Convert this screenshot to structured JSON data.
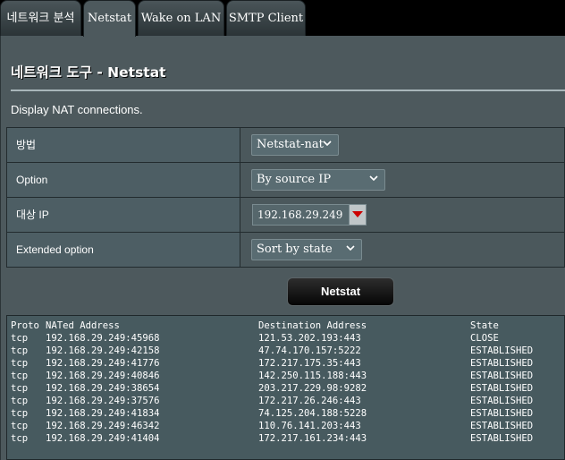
{
  "tabs": [
    {
      "label": "네트워크 분석"
    },
    {
      "label": "Netstat"
    },
    {
      "label": "Wake on LAN"
    },
    {
      "label": "SMTP Client"
    }
  ],
  "page": {
    "title": "네트워크 도구 - Netstat",
    "description": "Display NAT connections."
  },
  "form": {
    "method_label": "방법",
    "method_value": "Netstat-nat",
    "option_label": "Option",
    "option_value": "By source IP",
    "target_ip_label": "대상 IP",
    "target_ip_value": "192.168.29.249",
    "extended_label": "Extended option",
    "extended_value": "Sort by state"
  },
  "run_button": "Netstat",
  "output": {
    "headers": [
      "Proto",
      "NATed Address",
      "Destination Address",
      "State"
    ],
    "rows": [
      [
        "tcp",
        "192.168.29.249:45968",
        "121.53.202.193:443",
        "CLOSE"
      ],
      [
        "tcp",
        "192.168.29.249:42158",
        "47.74.170.157:5222",
        "ESTABLISHED"
      ],
      [
        "tcp",
        "192.168.29.249:41776",
        "172.217.175.35:443",
        "ESTABLISHED"
      ],
      [
        "tcp",
        "192.168.29.249:40846",
        "142.250.115.188:443",
        "ESTABLISHED"
      ],
      [
        "tcp",
        "192.168.29.249:38654",
        "203.217.229.98:9282",
        "ESTABLISHED"
      ],
      [
        "tcp",
        "192.168.29.249:37576",
        "172.217.26.246:443",
        "ESTABLISHED"
      ],
      [
        "tcp",
        "192.168.29.249:41834",
        "74.125.204.188:5228",
        "ESTABLISHED"
      ],
      [
        "tcp",
        "192.168.29.249:46342",
        "110.76.141.203:443",
        "ESTABLISHED"
      ],
      [
        "tcp",
        "192.168.29.249:41404",
        "172.217.161.234:443",
        "ESTABLISHED"
      ]
    ]
  },
  "colors": {
    "background": "#4d595d",
    "tabbar": "#000000",
    "dropdown_arrow": "#cc0000"
  }
}
